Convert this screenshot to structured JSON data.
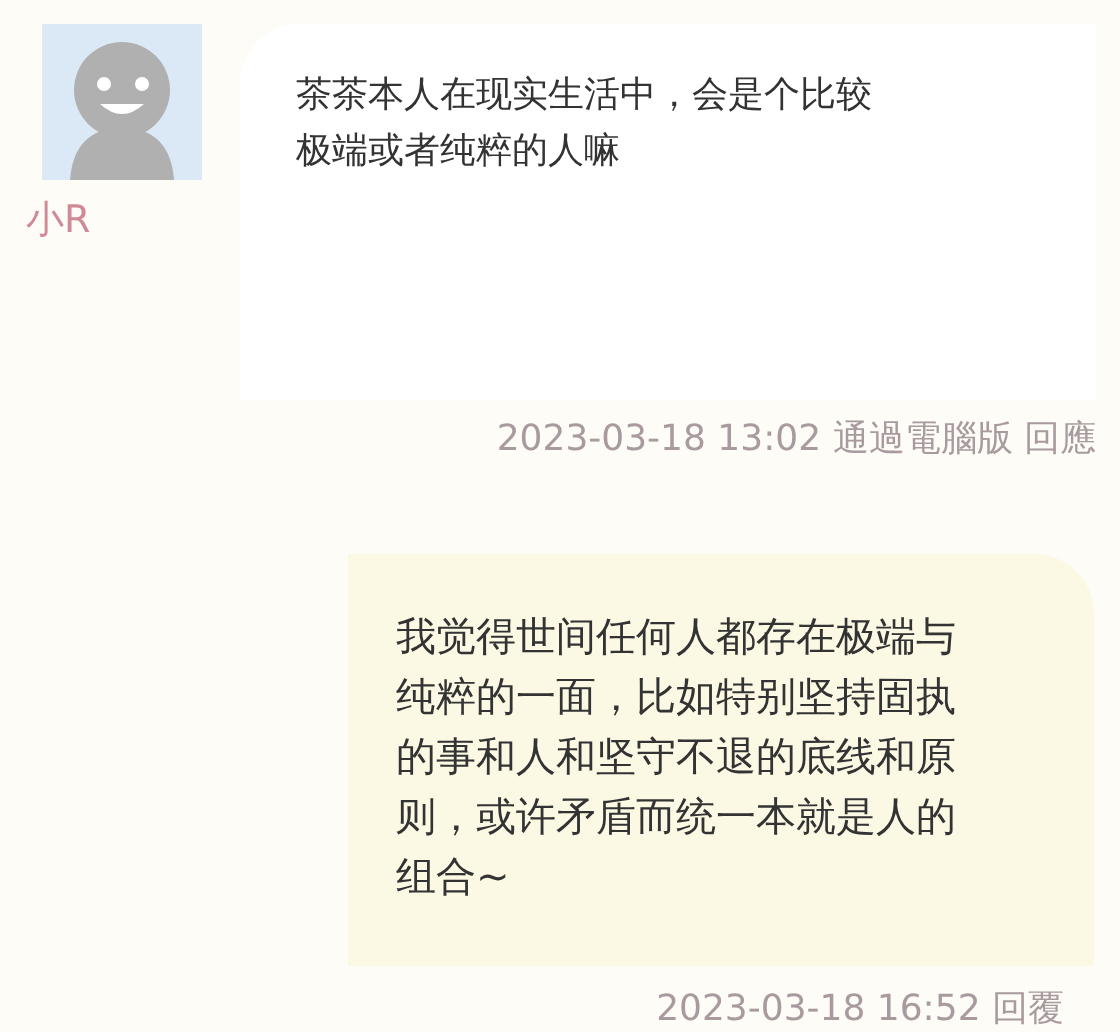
{
  "messages": [
    {
      "kind": "received",
      "sender": "小R",
      "text": "茶茶本人在现实生活中，会是个比较极端或者纯粹的人嘛",
      "meta": "2023-03-18 13:02 通過電腦版 回應"
    },
    {
      "kind": "sent",
      "text": "我觉得世间任何人都存在极端与纯粹的一面，比如特别坚持固执的事和人和坚守不退的底线和原则，或许矛盾而统一本就是人的组合~",
      "meta": "2023-03-18 16:52 回覆"
    }
  ]
}
